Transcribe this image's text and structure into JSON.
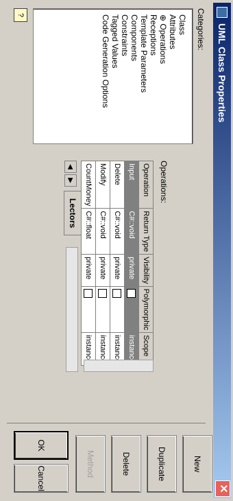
{
  "window": {
    "title": "UML Class Properties",
    "close_glyph": "✕"
  },
  "categories": {
    "label": "Categories:",
    "items": [
      {
        "label": "Class"
      },
      {
        "label": "Attributes"
      },
      {
        "label": "Operations",
        "selected": true
      },
      {
        "label": "Receptions"
      },
      {
        "label": "Template Parameters"
      },
      {
        "label": "Components"
      },
      {
        "label": "Constraints"
      },
      {
        "label": "Tagged Values"
      },
      {
        "label": "Code Generation Options"
      }
    ]
  },
  "operations": {
    "label": "Operations:",
    "headers": [
      "Operation",
      "Return Type",
      "Visibility",
      "Polymorphic",
      "Scope"
    ],
    "rows": [
      {
        "operation": "Input",
        "return_type": "C#::void",
        "visibility": "private",
        "polymorphic": false,
        "scope": "instance",
        "selected": true
      },
      {
        "operation": "Delete",
        "return_type": "C#::void",
        "visibility": "private",
        "polymorphic": false,
        "scope": "instance"
      },
      {
        "operation": "Modify",
        "return_type": "C#::void",
        "visibility": "private",
        "polymorphic": false,
        "scope": "instance"
      },
      {
        "operation": "CountMoney",
        "return_type": "C#::float",
        "visibility": "private",
        "polymorphic": false,
        "scope": "instance"
      }
    ],
    "tab_label": "Lectors"
  },
  "buttons": {
    "new": "New",
    "duplicate": "Duplicate",
    "delete": "Delete",
    "method": "Method",
    "ok": "OK",
    "cancel": "Cancel"
  }
}
